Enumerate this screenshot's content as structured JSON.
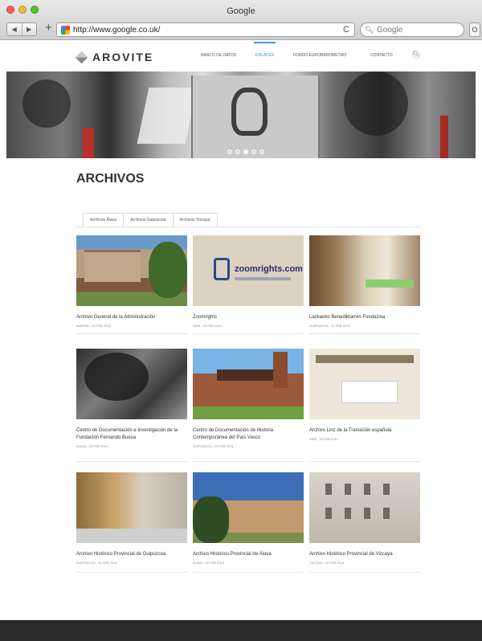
{
  "browser": {
    "window_title": "Google",
    "url": "http://www.google.co.uk/",
    "search_placeholder": "Google",
    "back_label": "◀",
    "forward_label": "▶",
    "new_tab_label": "+",
    "reload_label": "C",
    "download_label": "O"
  },
  "site": {
    "logo_text": "AROVITE",
    "nav": [
      "BANCO DE DATOS",
      "ENLACES",
      "FONDO EUROBAROMETRO",
      "CONTACTO"
    ],
    "nav_active_index": 1,
    "accent_color": "#3a9ad9",
    "hero_slides": 5,
    "hero_active_slide": 2
  },
  "page": {
    "title": "ARCHIVOS",
    "tabs": [
      "Archivos Álava",
      "Archivos Guipúzcoa",
      "Archivos Vizcaya"
    ]
  },
  "cards": [
    {
      "title": "Archivo General de la Administración",
      "meta": "MADRID - 20 FEB 2014",
      "image": "madrid-building"
    },
    {
      "title": "Zoomrights",
      "meta": "WEB - 20 FEB 2014",
      "image": "zoomrights-logo",
      "image_text": "zoomrights.com"
    },
    {
      "title": "Lazkaoko Benediktarren Fundazioa",
      "meta": "GUIPÚZCOA - 20 FEB 2014",
      "image": "office-interior"
    },
    {
      "title": "Centro de Documentación e Investigación de la Fundación Fernando Buesa",
      "meta": "ÁLAVA - 20 FEB 2014",
      "image": "forest-house"
    },
    {
      "title": "Centro de Documentación de Historia Contemporánea del País Vasco",
      "meta": "GUIPÚZCOA - 20 FEB 2014",
      "image": "palace"
    },
    {
      "title": "Archivo Linz de la Transición española",
      "meta": "WEB - 20 FEB 2014",
      "image": "web-screenshot"
    },
    {
      "title": "Archivo Histórico Provincial de Guipúzcoa",
      "meta": "GUIPÚZCOA - 20 FEB 2014",
      "image": "archive-interior"
    },
    {
      "title": "Archivo Histórico Provincial de Álava",
      "meta": "ÁLAVA - 20 FEB 2014",
      "image": "modern-building"
    },
    {
      "title": "Archivo Histórico Provincial de Vizcaya",
      "meta": "VIZCAYA - 20 FEB 2014",
      "image": "classic-facade"
    }
  ]
}
